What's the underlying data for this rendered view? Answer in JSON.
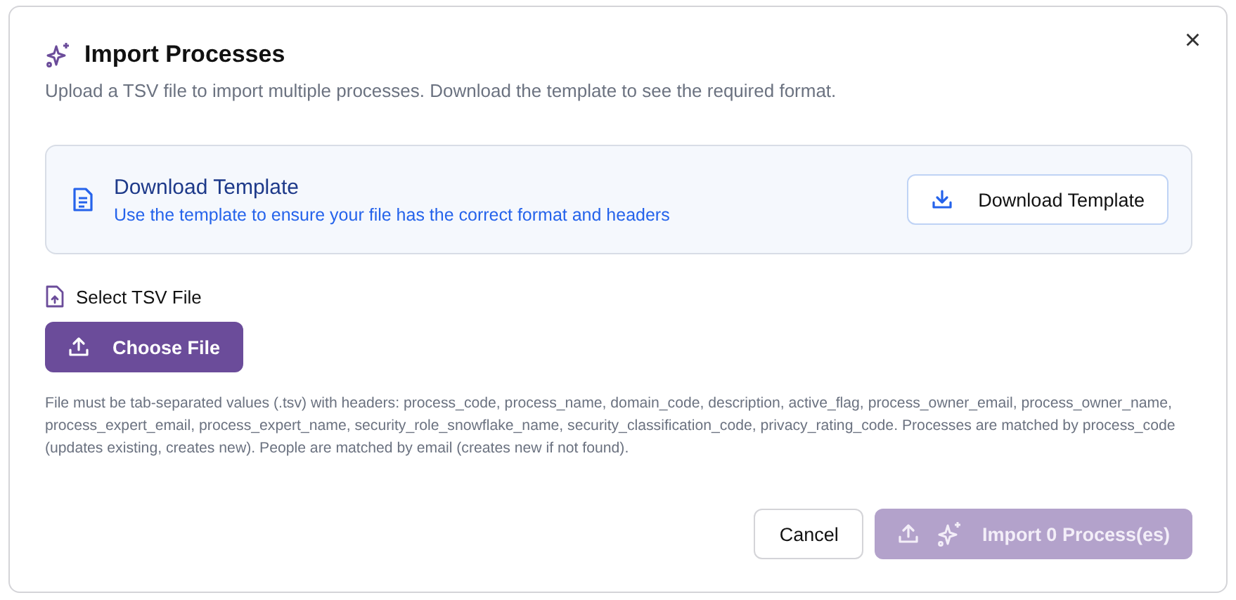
{
  "dialog": {
    "title": "Import Processes",
    "description": "Upload a TSV file to import multiple processes. Download the template to see the required format.",
    "close": "×"
  },
  "template_card": {
    "title": "Download Template",
    "description": "Use the template to ensure your file has the correct format and headers",
    "button": "Download Template"
  },
  "file_section": {
    "label": "Select TSV File",
    "button": "Choose File",
    "help": "File must be tab-separated values (.tsv) with headers: process_code, process_name, domain_code, description, active_flag, process_owner_email, process_owner_name, process_expert_email, process_expert_name, security_role_snowflake_name, security_classification_code, privacy_rating_code. Processes are matched by process_code (updates existing, creates new). People are matched by email (creates new if not found)."
  },
  "footer": {
    "cancel": "Cancel",
    "import": {
      "label": "Import 0 Process(es)",
      "disabled": true
    }
  }
}
